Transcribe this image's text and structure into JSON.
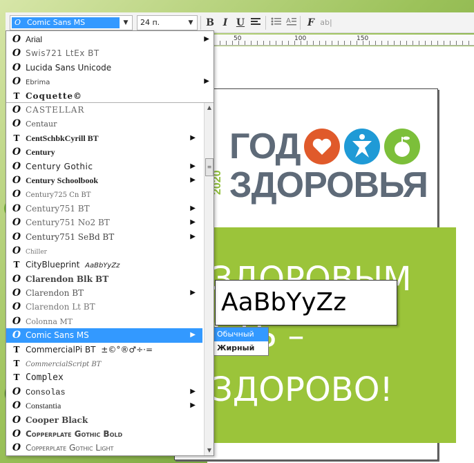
{
  "toolbar": {
    "font_value": "Comic Sans MS",
    "size_value": "24 п.",
    "bold": "B",
    "italic": "I",
    "underline": "U",
    "format_icon": "F",
    "case_icon": "ab|"
  },
  "ruler": {
    "labels": [
      "50",
      "100",
      "150"
    ]
  },
  "recent_fonts": [
    {
      "name": "Arial",
      "submenu": true,
      "icon": "O"
    },
    {
      "name": "Swis721 LtEx BT",
      "submenu": false,
      "icon": "O"
    },
    {
      "name": "Lucida Sans Unicode",
      "submenu": false,
      "icon": "O"
    },
    {
      "name": "Ebrima",
      "submenu": true,
      "icon": "O"
    },
    {
      "name": "Coquette©",
      "submenu": false,
      "icon": "T"
    }
  ],
  "font_list": [
    {
      "name": "CASTELLAR",
      "submenu": false,
      "icon": "O"
    },
    {
      "name": "Centaur",
      "submenu": false,
      "icon": "O"
    },
    {
      "name": "CentSchbkCyrill BT",
      "submenu": true,
      "icon": "T"
    },
    {
      "name": "Century",
      "submenu": false,
      "icon": "O"
    },
    {
      "name": "Century Gothic",
      "submenu": true,
      "icon": "O"
    },
    {
      "name": "Century Schoolbook",
      "submenu": true,
      "icon": "O"
    },
    {
      "name": "Century725 Cn BT",
      "submenu": false,
      "icon": "O"
    },
    {
      "name": "Century751 BT",
      "submenu": true,
      "icon": "O"
    },
    {
      "name": "Century751 No2 BT",
      "submenu": true,
      "icon": "O"
    },
    {
      "name": "Century751 SeBd BT",
      "submenu": true,
      "icon": "O"
    },
    {
      "name": "Chiller",
      "submenu": false,
      "icon": "O"
    },
    {
      "name": "CityBlueprint",
      "preview": "AaBbYyZz",
      "submenu": false,
      "icon": "T"
    },
    {
      "name": "Clarendon Blk BT",
      "submenu": false,
      "icon": "O"
    },
    {
      "name": "Clarendon BT",
      "submenu": true,
      "icon": "O"
    },
    {
      "name": "Clarendon Lt BT",
      "submenu": false,
      "icon": "O"
    },
    {
      "name": "Colonna MT",
      "submenu": false,
      "icon": "O"
    },
    {
      "name": "Comic Sans MS",
      "submenu": true,
      "icon": "O",
      "selected": true
    },
    {
      "name": "CommercialPi BT",
      "preview": "±©°®♂÷·=",
      "submenu": false,
      "icon": "T"
    },
    {
      "name": "CommercialScript BT",
      "submenu": false,
      "icon": "T"
    },
    {
      "name": "Complex",
      "submenu": false,
      "icon": "T"
    },
    {
      "name": "Consolas",
      "submenu": true,
      "icon": "O"
    },
    {
      "name": "Constantia",
      "submenu": true,
      "icon": "O"
    },
    {
      "name": "Cooper Black",
      "submenu": false,
      "icon": "O"
    },
    {
      "name": "Copperplate Gothic Bold",
      "submenu": false,
      "icon": "O"
    },
    {
      "name": "Copperplate Gothic Light",
      "submenu": false,
      "icon": "O"
    }
  ],
  "preview_popup": {
    "text": "AaBbYyZz"
  },
  "style_submenu": [
    {
      "label": "Обычный",
      "selected": true
    },
    {
      "label": "Жирный",
      "selected": false
    }
  ],
  "document": {
    "logo_year": "2020",
    "logo_line1": "ГОД",
    "logo_line2": "ЗДОРОВЬЯ",
    "slogan_line1": "ЗДОРОВЫМ",
    "slogan_line2": "ЬТЬ –",
    "slogan_line3": "ЗДОРОВО!"
  },
  "colors": {
    "accent": "#3399ff",
    "logo_gray": "#5e6a78",
    "logo_green": "#8fbf3a",
    "heart_orange": "#e05a2b",
    "person_blue": "#1f9ad6",
    "apple_green": "#7cbf3a",
    "panel_green": "#9bc43a"
  }
}
